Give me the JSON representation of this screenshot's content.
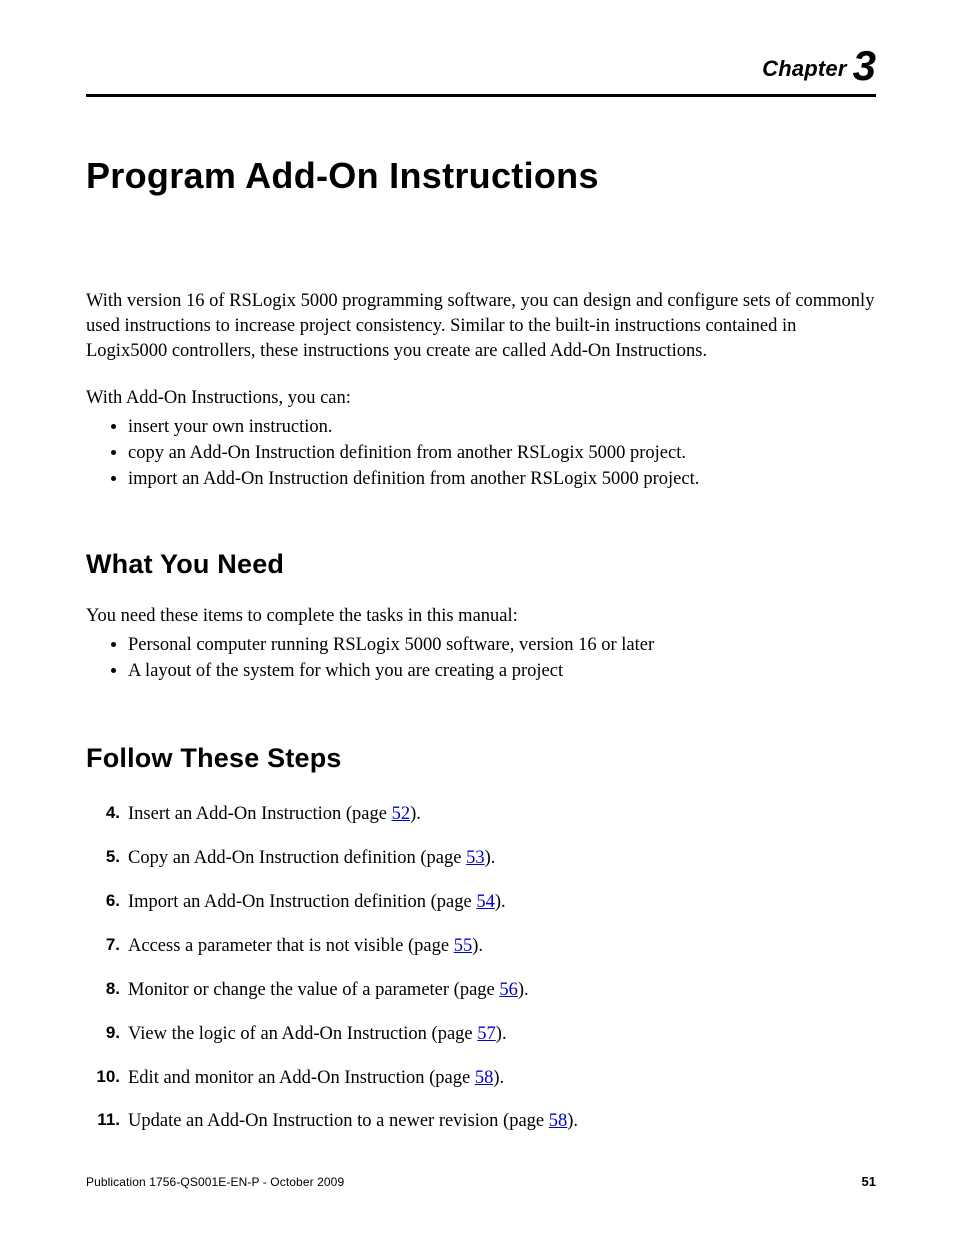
{
  "chapter": {
    "label": "Chapter",
    "number": "3"
  },
  "title": "Program Add-On Instructions",
  "intro1": "With version 16 of RSLogix 5000 programming software, you can design and configure sets of commonly used instructions to increase project consistency. Similar to the built-in instructions contained in Logix5000 controllers, these instructions you create are called Add-On Instructions.",
  "intro2": "With Add-On Instructions, you can:",
  "intro_bullets": [
    "insert your own instruction.",
    "copy an Add-On Instruction definition from another RSLogix 5000 project.",
    "import an Add-On Instruction definition from another RSLogix 5000 project."
  ],
  "sections": {
    "need": {
      "heading": "What You Need",
      "intro": "You need these items to complete the tasks in this manual:",
      "items": [
        "Personal computer running RSLogix 5000 software, version 16 or later",
        "A layout of the system for which you are creating a project"
      ]
    },
    "steps": {
      "heading": "Follow These Steps",
      "items": [
        {
          "n": "4.",
          "pre": "Insert an Add-On Instruction (page ",
          "page": "52",
          "post": ")."
        },
        {
          "n": "5.",
          "pre": "Copy an Add-On Instruction definition (page ",
          "page": "53",
          "post": ")."
        },
        {
          "n": "6.",
          "pre": "Import an Add-On Instruction definition (page ",
          "page": "54",
          "post": ")."
        },
        {
          "n": "7.",
          "pre": "Access a parameter that is not visible (page ",
          "page": "55",
          "post": ")."
        },
        {
          "n": "8.",
          "pre": "Monitor or change the value of a parameter (page ",
          "page": "56",
          "post": ")."
        },
        {
          "n": "9.",
          "pre": "View the logic of an Add-On Instruction (page ",
          "page": "57",
          "post": ")."
        },
        {
          "n": "10.",
          "pre": "Edit and monitor an Add-On Instruction (page ",
          "page": "58",
          "post": ")."
        },
        {
          "n": "11.",
          "pre": "Update an Add-On Instruction to a newer revision (page ",
          "page": "58",
          "post": ")."
        }
      ]
    }
  },
  "footer": {
    "publication": "Publication 1756-QS001E-EN-P - October 2009",
    "page_number": "51"
  }
}
